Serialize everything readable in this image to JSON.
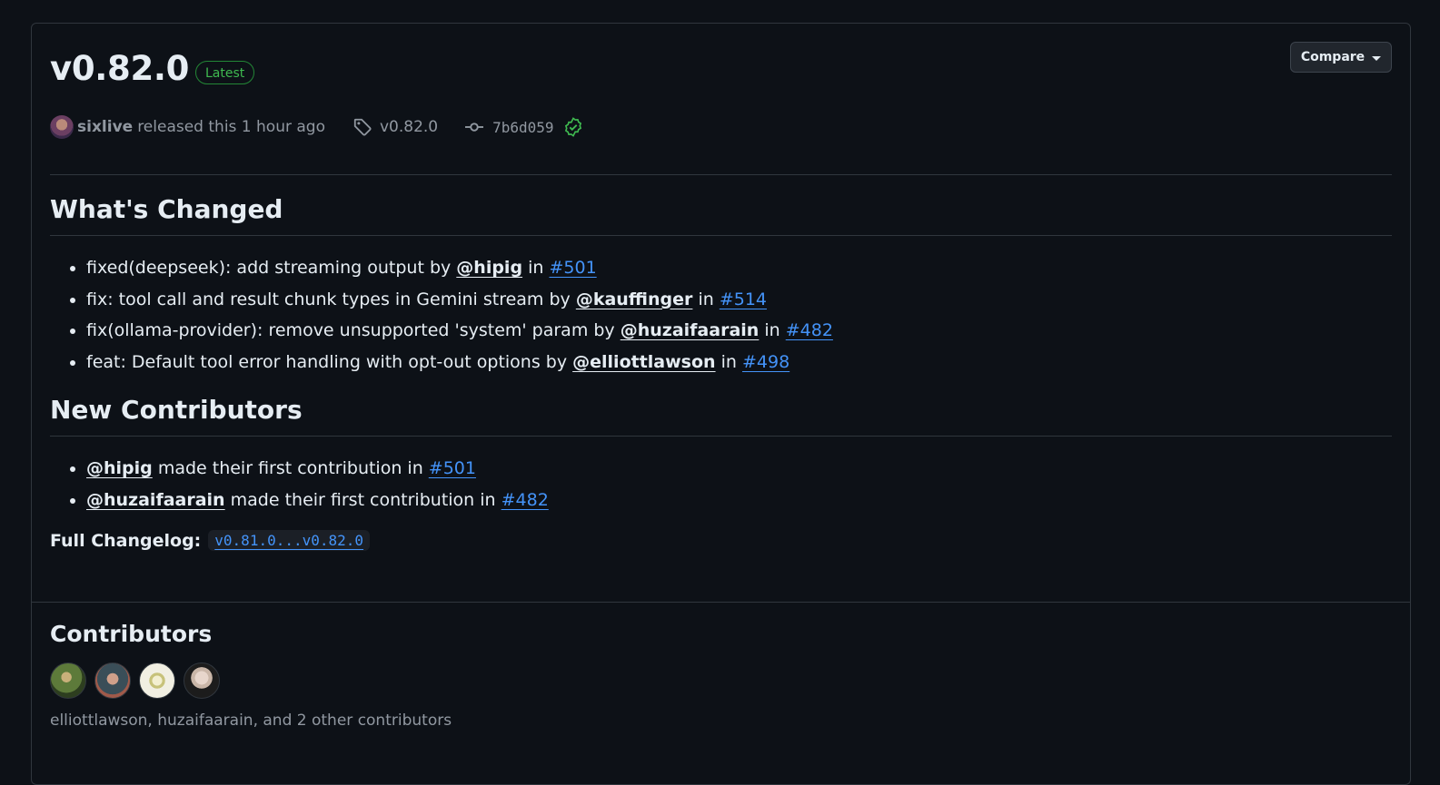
{
  "release": {
    "version": "v0.82.0",
    "badge": "Latest",
    "compare_label": "Compare",
    "author": "sixlive",
    "released_text": "released this 1 hour ago",
    "tag": "v0.82.0",
    "commit": "7b6d059"
  },
  "whats_changed": {
    "heading": "What's Changed",
    "items": [
      {
        "text": "fixed(deepseek): add streaming output by",
        "mention": "@hipig",
        "in": "in",
        "pr": "#501"
      },
      {
        "text": "fix: tool call and result chunk types in Gemini stream by",
        "mention": "@kauffinger",
        "in": "in",
        "pr": "#514"
      },
      {
        "text": "fix(ollama-provider): remove unsupported 'system' param by",
        "mention": "@huzaifaarain",
        "in": "in",
        "pr": "#482"
      },
      {
        "text": "feat: Default tool error handling with opt-out options by",
        "mention": "@elliottlawson",
        "in": "in",
        "pr": "#498"
      }
    ]
  },
  "new_contributors": {
    "heading": "New Contributors",
    "items": [
      {
        "mention": "@hipig",
        "text": "made their first contribution in",
        "pr": "#501"
      },
      {
        "mention": "@huzaifaarain",
        "text": "made their first contribution in",
        "pr": "#482"
      }
    ]
  },
  "changelog": {
    "label": "Full Changelog:",
    "range": "v0.81.0...v0.82.0"
  },
  "contributors": {
    "heading": "Contributors",
    "summary": "elliottlawson, huzaifaarain, and 2 other contributors"
  }
}
